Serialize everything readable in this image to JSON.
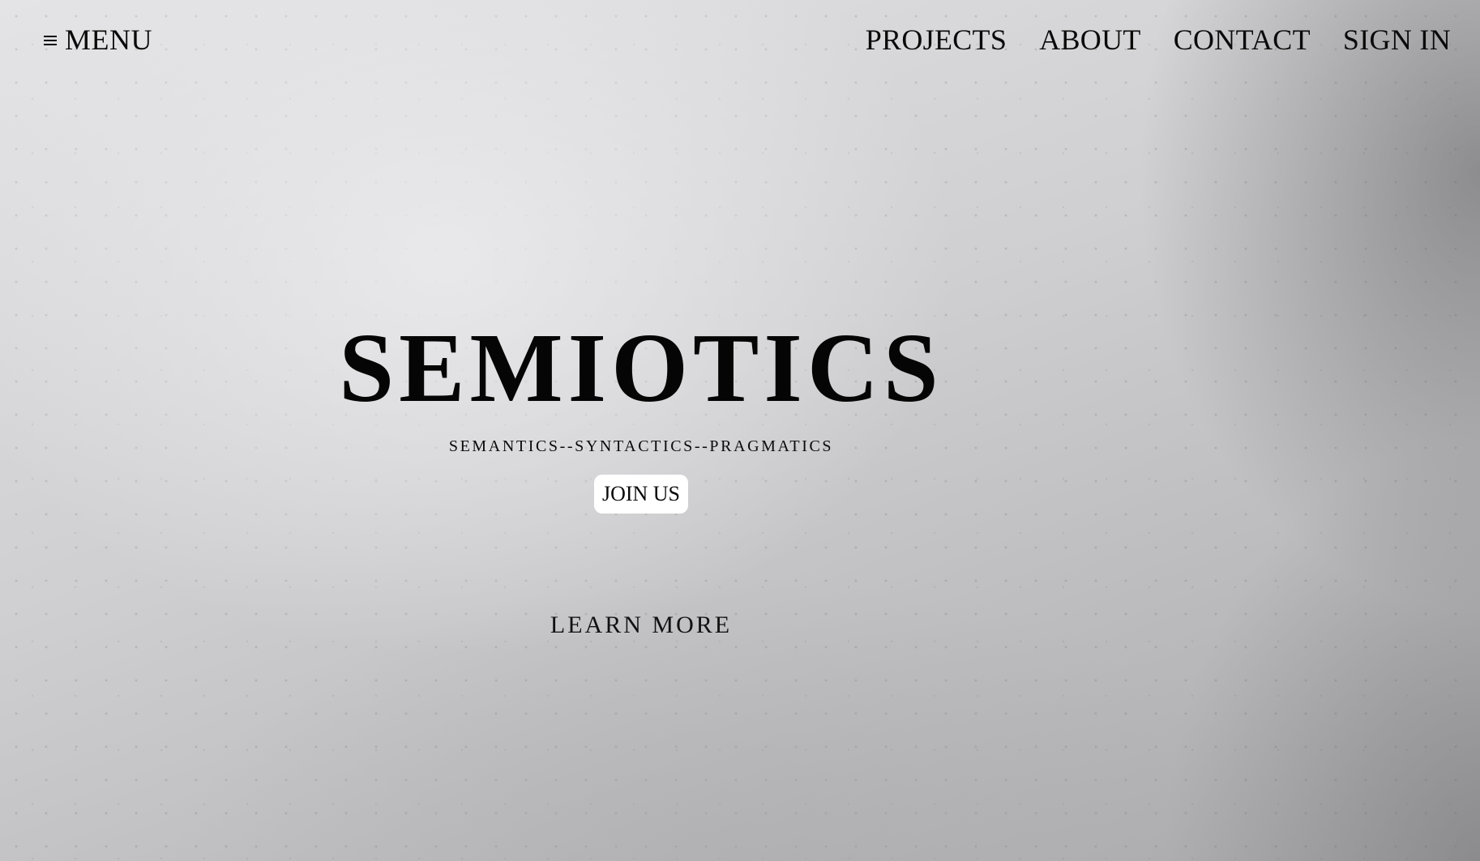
{
  "nav": {
    "menu_label": "MENU",
    "links": [
      {
        "label": "PROJECTS"
      },
      {
        "label": "ABOUT"
      },
      {
        "label": "CONTACT"
      },
      {
        "label": "SIGN IN"
      }
    ]
  },
  "hero": {
    "title": "SEMIOTICS",
    "subtitle": "SEMANTICS--SYNTACTICS--PRAGMATICS",
    "cta_label": "JOIN US",
    "learn_more_label": "LEARN MORE"
  },
  "icons": {
    "menu": "hamburger-icon"
  },
  "colors": {
    "text": "#0a0a0a",
    "button_bg": "#ffffff",
    "background": "#d4d4d6"
  }
}
